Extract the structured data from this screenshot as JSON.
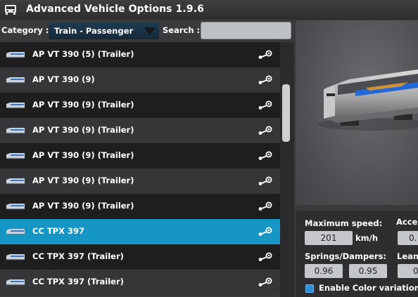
{
  "window": {
    "title": "Advanced Vehicle Options 1.9.6",
    "icon": "vehicle-icon"
  },
  "filter": {
    "category_label": "Category :",
    "category_value": "Train - Passenger",
    "search_label": "Search :",
    "search_value": "",
    "search_placeholder": ""
  },
  "list": {
    "selected_index": 7,
    "items": [
      {
        "name": "AP VT 390 (5) (Trailer)"
      },
      {
        "name": "AP VT 390 (9)"
      },
      {
        "name": "AP VT 390 (9) (Trailer)"
      },
      {
        "name": "AP VT 390 (9) (Trailer)"
      },
      {
        "name": "AP VT 390 (9) (Trailer)"
      },
      {
        "name": "AP VT 390 (9) (Trailer)"
      },
      {
        "name": "AP VT 390 (9) (Trailer)"
      },
      {
        "name": "CC TPX 397"
      },
      {
        "name": "CC TPX 397 (Trailer)"
      },
      {
        "name": "CC TPX 397 (Trailer)"
      }
    ]
  },
  "properties": {
    "max_speed_label": "Maximum speed:",
    "max_speed_value": "201",
    "max_speed_unit": "km/h",
    "accel_label": "Acce",
    "accel_value": "0.",
    "springs_label": "Springs/Dampers:",
    "springs_value": "0.96",
    "dampers_value": "0.95",
    "lean_label": "Lean",
    "lean_value": "0",
    "color_variations_label": "Enable Color variations",
    "color_variations_checked": true
  },
  "colors": {
    "row_dark": "#1e1e1f",
    "row_light": "#363638",
    "row_selected": "#1696c4",
    "accent": "#2f90d8"
  }
}
